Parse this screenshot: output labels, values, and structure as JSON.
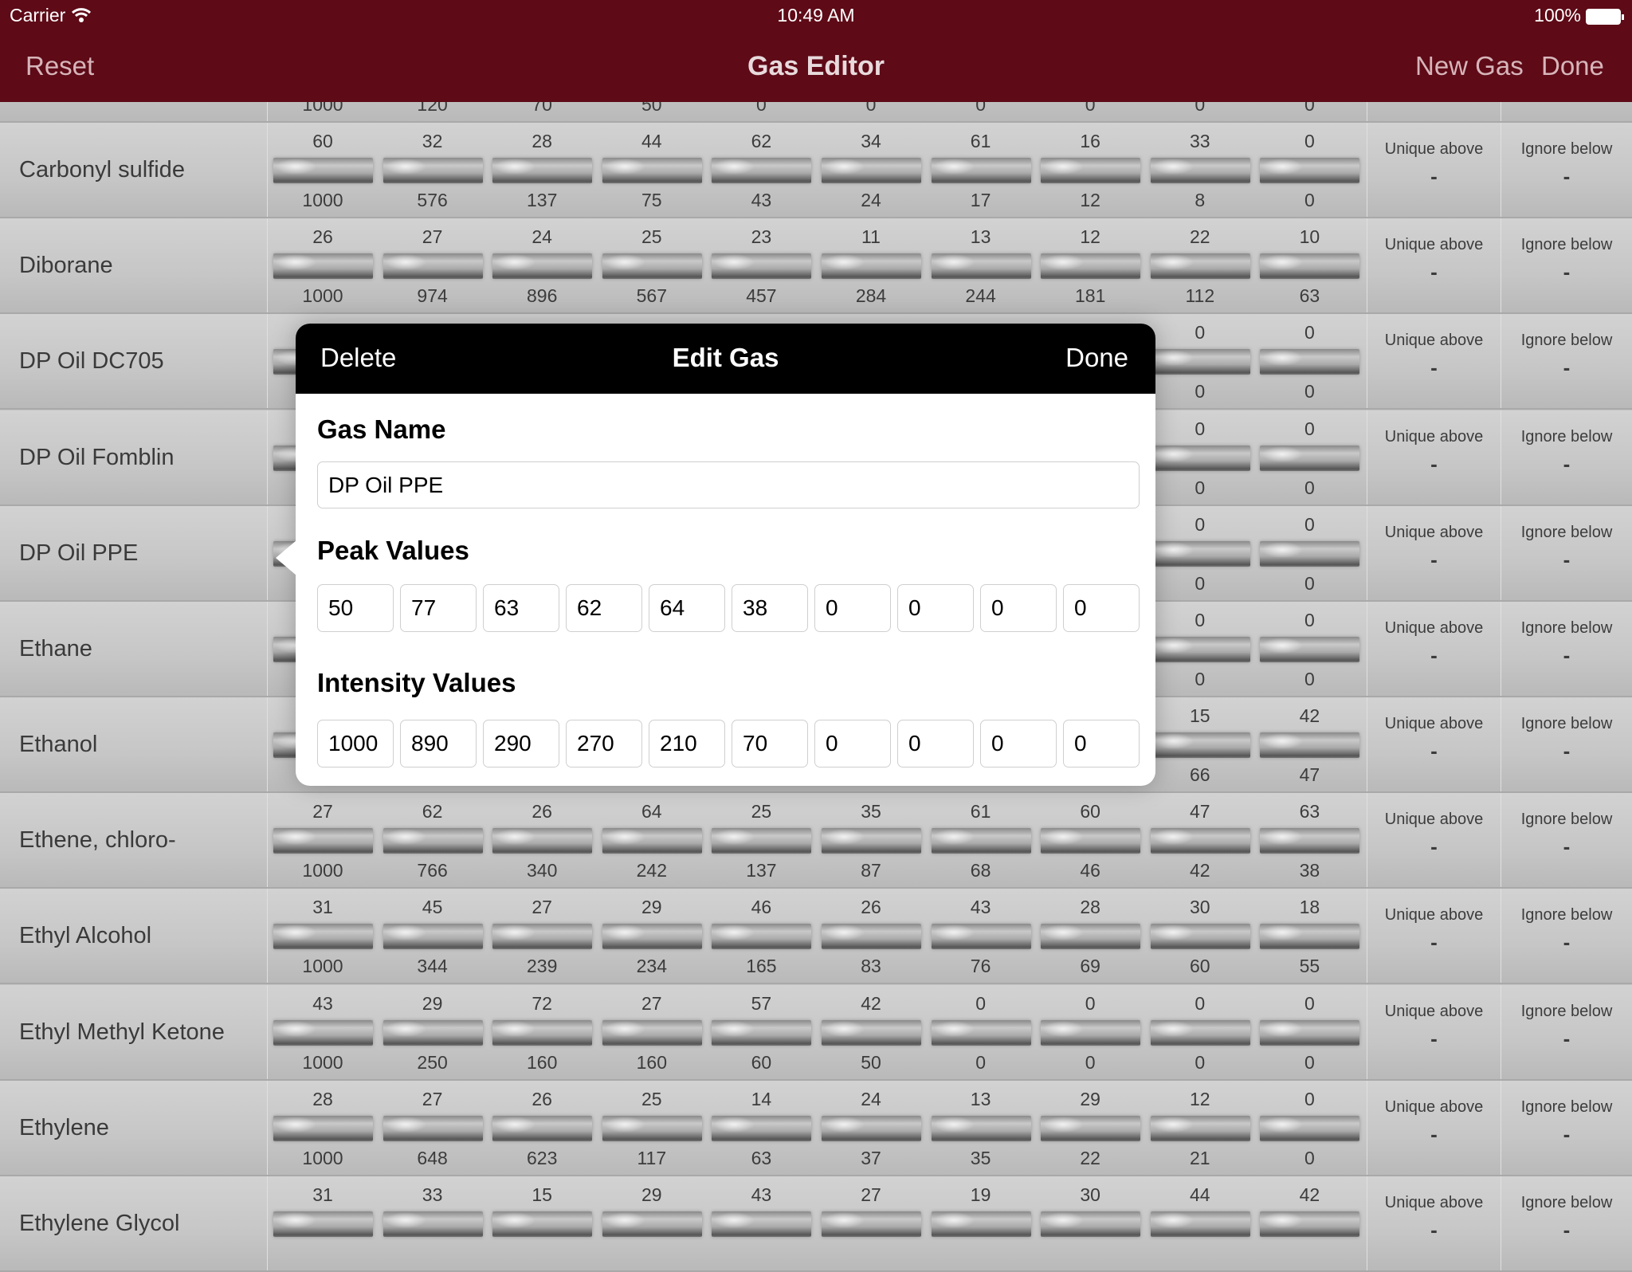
{
  "status_bar": {
    "carrier": "Carrier",
    "time": "10:49 AM",
    "battery": "100%"
  },
  "nav": {
    "title": "Gas Editor",
    "reset": "Reset",
    "new_gas": "New Gas",
    "done": "Done"
  },
  "colors": {
    "nav_bar": "#5e0a17",
    "popover_header": "#000000"
  },
  "column_labels": {
    "unique_above": "Unique above",
    "ignore_below": "Ignore below",
    "empty_value": "-"
  },
  "rows": [
    {
      "name": "",
      "peaks": [
        "",
        "",
        "",
        "",
        "",
        "",
        "",
        "",
        "",
        ""
      ],
      "intensities": [
        "1000",
        "120",
        "70",
        "50",
        "0",
        "0",
        "0",
        "0",
        "0",
        "0"
      ],
      "partial": true
    },
    {
      "name": "Carbonyl sulfide",
      "peaks": [
        "60",
        "32",
        "28",
        "44",
        "62",
        "34",
        "61",
        "16",
        "33",
        "0"
      ],
      "intensities": [
        "1000",
        "576",
        "137",
        "75",
        "43",
        "24",
        "17",
        "12",
        "8",
        "0"
      ]
    },
    {
      "name": "Diborane",
      "peaks": [
        "26",
        "27",
        "24",
        "25",
        "23",
        "11",
        "13",
        "12",
        "22",
        "10"
      ],
      "intensities": [
        "1000",
        "974",
        "896",
        "567",
        "457",
        "284",
        "244",
        "181",
        "112",
        "63"
      ]
    },
    {
      "name": "DP Oil DC705",
      "peaks": [
        "",
        "",
        "",
        "",
        "",
        "",
        "",
        "",
        "0",
        "0"
      ],
      "intensities": [
        "",
        "",
        "",
        "",
        "",
        "",
        "",
        "",
        "0",
        "0"
      ]
    },
    {
      "name": "DP Oil Fomblin",
      "peaks": [
        "",
        "",
        "",
        "",
        "",
        "",
        "",
        "",
        "0",
        "0"
      ],
      "intensities": [
        "",
        "",
        "",
        "",
        "",
        "",
        "",
        "",
        "0",
        "0"
      ]
    },
    {
      "name": "DP Oil PPE",
      "peaks": [
        "",
        "",
        "",
        "",
        "",
        "",
        "",
        "",
        "0",
        "0"
      ],
      "intensities": [
        "",
        "",
        "",
        "",
        "",
        "",
        "",
        "",
        "0",
        "0"
      ]
    },
    {
      "name": "Ethane",
      "peaks": [
        "",
        "",
        "",
        "",
        "",
        "",
        "",
        "",
        "0",
        "0"
      ],
      "intensities": [
        "",
        "",
        "",
        "",
        "",
        "",
        "",
        "",
        "0",
        "0"
      ]
    },
    {
      "name": "Ethanol",
      "peaks": [
        "",
        "",
        "",
        "",
        "",
        "",
        "",
        "",
        "15",
        "42"
      ],
      "intensities": [
        "",
        "",
        "",
        "",
        "",
        "",
        "",
        "",
        "66",
        "47"
      ]
    },
    {
      "name": "Ethene, chloro-",
      "peaks": [
        "27",
        "62",
        "26",
        "64",
        "25",
        "35",
        "61",
        "60",
        "47",
        "63"
      ],
      "intensities": [
        "1000",
        "766",
        "340",
        "242",
        "137",
        "87",
        "68",
        "46",
        "42",
        "38"
      ]
    },
    {
      "name": "Ethyl Alcohol",
      "peaks": [
        "31",
        "45",
        "27",
        "29",
        "46",
        "26",
        "43",
        "28",
        "30",
        "18"
      ],
      "intensities": [
        "1000",
        "344",
        "239",
        "234",
        "165",
        "83",
        "76",
        "69",
        "60",
        "55"
      ]
    },
    {
      "name": "Ethyl Methyl Ketone",
      "peaks": [
        "43",
        "29",
        "72",
        "27",
        "57",
        "42",
        "0",
        "0",
        "0",
        "0"
      ],
      "intensities": [
        "1000",
        "250",
        "160",
        "160",
        "60",
        "50",
        "0",
        "0",
        "0",
        "0"
      ]
    },
    {
      "name": "Ethylene",
      "peaks": [
        "28",
        "27",
        "26",
        "25",
        "14",
        "24",
        "13",
        "29",
        "12",
        "0"
      ],
      "intensities": [
        "1000",
        "648",
        "623",
        "117",
        "63",
        "37",
        "35",
        "22",
        "21",
        "0"
      ]
    },
    {
      "name": "Ethylene Glycol",
      "peaks": [
        "31",
        "33",
        "15",
        "29",
        "43",
        "27",
        "19",
        "30",
        "44",
        "42"
      ],
      "intensities": [
        "",
        "",
        "",
        "",
        "",
        "",
        "",
        "",
        "",
        ""
      ]
    }
  ],
  "edit_gas": {
    "title": "Edit Gas",
    "delete": "Delete",
    "done": "Done",
    "gas_name_label": "Gas Name",
    "gas_name_value": "DP Oil PPE",
    "peak_values_label": "Peak Values",
    "peak_values": [
      "50",
      "77",
      "63",
      "62",
      "64",
      "38",
      "0",
      "0",
      "0",
      "0"
    ],
    "intensity_values_label": "Intensity Values",
    "intensity_values": [
      "1000",
      "890",
      "290",
      "270",
      "210",
      "70",
      "0",
      "0",
      "0",
      "0"
    ]
  }
}
